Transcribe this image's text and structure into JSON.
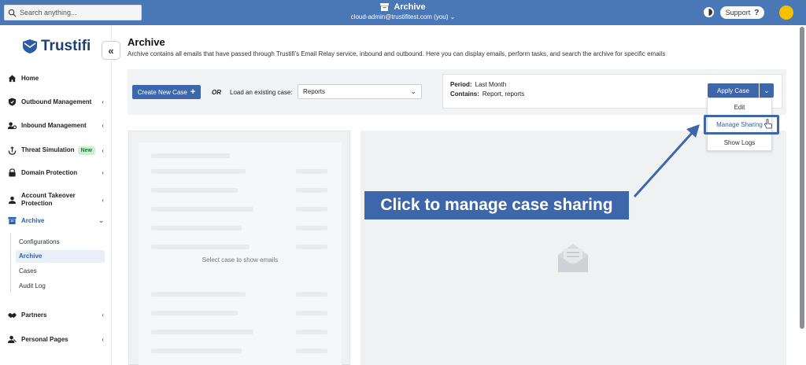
{
  "topbar": {
    "search_placeholder": "Search anything...",
    "title": "Archive",
    "user": "cloud-admin@trustifitest.com (you)",
    "support_label": "Support",
    "support_glyph": "?"
  },
  "sidebar": {
    "brand": "Trustifi",
    "collapse_glyph": "«",
    "items": [
      {
        "label": "Home",
        "icon": "home-icon"
      },
      {
        "label": "Outbound Management",
        "icon": "shield-icon"
      },
      {
        "label": "Inbound Management",
        "icon": "inbound-icon"
      },
      {
        "label": "Threat Simulation",
        "icon": "hook-icon",
        "badge": "New"
      },
      {
        "label": "Domain Protection",
        "icon": "lock-icon"
      },
      {
        "label": "Account Takeover Protection",
        "icon": "account-icon"
      },
      {
        "label": "Archive",
        "icon": "archive-icon"
      },
      {
        "label": "Partners",
        "icon": "handshake-icon"
      },
      {
        "label": "Personal Pages",
        "icon": "person-icon"
      }
    ],
    "archive_sub": [
      "Configurations",
      "Archive",
      "Cases",
      "Audit Log"
    ]
  },
  "main": {
    "title": "Archive",
    "description": "Archive contains all emails that have passed through Trustifi's Email Relay service, inbound and outbound. Here you can display emails, perform tasks, and search the archive for specific emails",
    "create_case_label": "Create New Case",
    "or_label": "OR",
    "load_label": "Load an existing case:",
    "selected_case": "Reports",
    "period_label": "Period:",
    "period_value": "Last Month",
    "contains_label": "Contains:",
    "contains_value": "Report, reports",
    "apply_label": "Apply Case",
    "dropdown": [
      "Edit",
      "Manage Sharing",
      "Show Logs"
    ],
    "empty_message": "Select case to show emails"
  },
  "annotation": {
    "callout": "Click to manage case sharing"
  },
  "colors": {
    "topbar": "#4a78b6",
    "primary": "#3d67aa",
    "avatar": "#f5c000"
  }
}
